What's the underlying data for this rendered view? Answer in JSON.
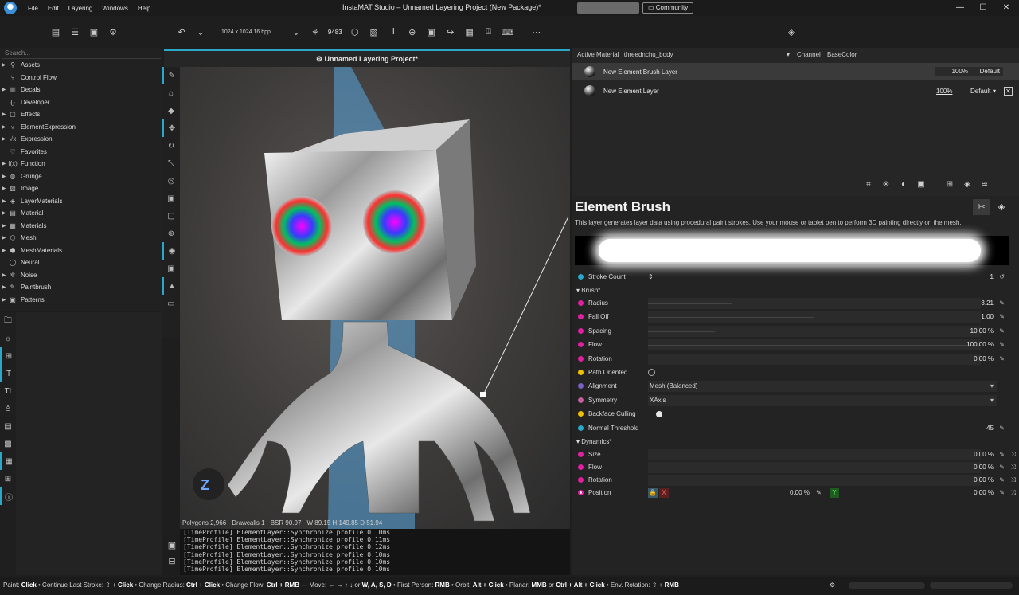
{
  "titlebar": {
    "logo": "instamat-logo",
    "menu": [
      "File",
      "Edit",
      "Layering",
      "Windows",
      "Help"
    ],
    "title": "InstaMAT Studio  –  Unnamed Layering Project (New Package)*",
    "community": "Community"
  },
  "toolbar": {
    "resolution": "1024 x 1024 16 bpp",
    "count": "9483"
  },
  "sidebar": {
    "search_placeholder": "Search...",
    "items": [
      {
        "label": "Assets",
        "icon": "assets-icon",
        "expandable": true
      },
      {
        "label": "Control Flow",
        "icon": "control-flow-icon",
        "expandable": false
      },
      {
        "label": "Decals",
        "icon": "decals-icon",
        "expandable": true
      },
      {
        "label": "Developer",
        "icon": "developer-icon",
        "expandable": false
      },
      {
        "label": "Effects",
        "icon": "effects-icon",
        "expandable": true
      },
      {
        "label": "ElementExpression",
        "icon": "element-expression-icon",
        "expandable": true
      },
      {
        "label": "Expression",
        "icon": "expression-icon",
        "expandable": true
      },
      {
        "label": "Favorites",
        "icon": "favorites-icon",
        "expandable": false
      },
      {
        "label": "Function",
        "icon": "function-icon",
        "expandable": true
      },
      {
        "label": "Grunge",
        "icon": "grunge-icon",
        "expandable": true
      },
      {
        "label": "Image",
        "icon": "image-icon",
        "expandable": true
      },
      {
        "label": "LayerMaterials",
        "icon": "layer-materials-icon",
        "expandable": true
      },
      {
        "label": "Material",
        "icon": "material-icon",
        "expandable": true
      },
      {
        "label": "Materials",
        "icon": "materials-icon",
        "expandable": true
      },
      {
        "label": "Mesh",
        "icon": "mesh-icon",
        "expandable": true
      },
      {
        "label": "MeshMaterials",
        "icon": "mesh-materials-icon",
        "expandable": true
      },
      {
        "label": "Neural",
        "icon": "neural-icon",
        "expandable": false
      },
      {
        "label": "Noise",
        "icon": "noise-icon",
        "expandable": true
      },
      {
        "label": "Paintbrush",
        "icon": "paintbrush-icon",
        "expandable": true
      },
      {
        "label": "Patterns",
        "icon": "patterns-icon",
        "expandable": true
      }
    ]
  },
  "viewport": {
    "tab_title": "Unnamed Layering Project*",
    "stats": "Polygons 2,966 · Drawcalls 1 · BSR 90.97 · W 89.15 H 149.85 D 51.94"
  },
  "console": {
    "lines": [
      "[TimeProfile] ElementLayer::Synchronize profile 0.10ms",
      "[TimeProfile] ElementLayer::Synchronize profile 0.11ms",
      "[TimeProfile] ElementLayer::Synchronize profile 0.12ms",
      "[TimeProfile] ElementLayer::Synchronize profile 0.10ms",
      "[TimeProfile] ElementLayer::Synchronize profile 0.10ms",
      "[TimeProfile] ElementLayer::Synchronize profile 0.10ms"
    ]
  },
  "layers": {
    "active_material_label": "Active Material",
    "active_material": "threednchu_body",
    "channel_label": "Channel",
    "channel": "BaseColor",
    "rows": [
      {
        "name": "New Element Brush Layer",
        "opacity": "100%",
        "blend": "Default"
      },
      {
        "name": "New Element Layer",
        "opacity": "100%",
        "blend": "Default"
      }
    ]
  },
  "properties": {
    "title": "Element Brush",
    "description": "This layer generates layer data using procedural paint strokes. Use your mouse or tablet pen to perform 3D painting directly on the mesh.",
    "stroke_count": {
      "label": "Stroke Count",
      "value": "1"
    },
    "brush_group": "Brush*",
    "brush": [
      {
        "label": "Radius",
        "value": "3.21",
        "color": "#e020a0"
      },
      {
        "label": "Fall Off",
        "value": "1.00",
        "color": "#e020a0"
      },
      {
        "label": "Spacing",
        "value": "10.00 %",
        "color": "#e020a0"
      },
      {
        "label": "Flow",
        "value": "100.00 %",
        "color": "#e020a0"
      },
      {
        "label": "Rotation",
        "value": "0.00 %",
        "color": "#e020a0"
      }
    ],
    "path_oriented": {
      "label": "Path Oriented"
    },
    "alignment": {
      "label": "Alignment",
      "value": "Mesh (Balanced)"
    },
    "symmetry": {
      "label": "Symmetry",
      "value": "XAxis"
    },
    "backface_culling": {
      "label": "Backface Culling"
    },
    "normal_threshold": {
      "label": "Normal Threshold",
      "value": "45"
    },
    "dynamics_group": "Dynamics*",
    "dynamics": [
      {
        "label": "Size",
        "value": "0.00 %"
      },
      {
        "label": "Flow",
        "value": "0.00 %"
      },
      {
        "label": "Rotation",
        "value": "0.00 %"
      }
    ],
    "position": {
      "label": "Position",
      "x_label": "X",
      "x_value": "0.00 %",
      "y_label": "Y",
      "y_value": "0.00 %"
    }
  },
  "statusbar": {
    "parts": [
      {
        "t": "Paint: ",
        "b": false
      },
      {
        "t": "Click",
        "b": true
      },
      {
        "t": " • Continue Last Stroke: ⇧ + ",
        "b": false
      },
      {
        "t": "Click",
        "b": true
      },
      {
        "t": " • Change Radius: ",
        "b": false
      },
      {
        "t": "Ctrl + Click",
        "b": true
      },
      {
        "t": " • Change Flow: ",
        "b": false
      },
      {
        "t": "Ctrl + RMB",
        "b": true
      },
      {
        "t": " — Move: ← → ↑ ↓ or ",
        "b": false
      },
      {
        "t": "W, A, S, D",
        "b": true
      },
      {
        "t": " • First Person: ",
        "b": false
      },
      {
        "t": "RMB",
        "b": true
      },
      {
        "t": " • Orbit: ",
        "b": false
      },
      {
        "t": "Alt + Click",
        "b": true
      },
      {
        "t": " • Planar: ",
        "b": false
      },
      {
        "t": "MMB",
        "b": true
      },
      {
        "t": " or ",
        "b": false
      },
      {
        "t": "Ctrl + Alt + Click",
        "b": true
      },
      {
        "t": " • Env. Rotation: ⇧ + ",
        "b": false
      },
      {
        "t": "RMB",
        "b": true
      }
    ]
  },
  "colors": {
    "accent": "#2aa7c9"
  }
}
